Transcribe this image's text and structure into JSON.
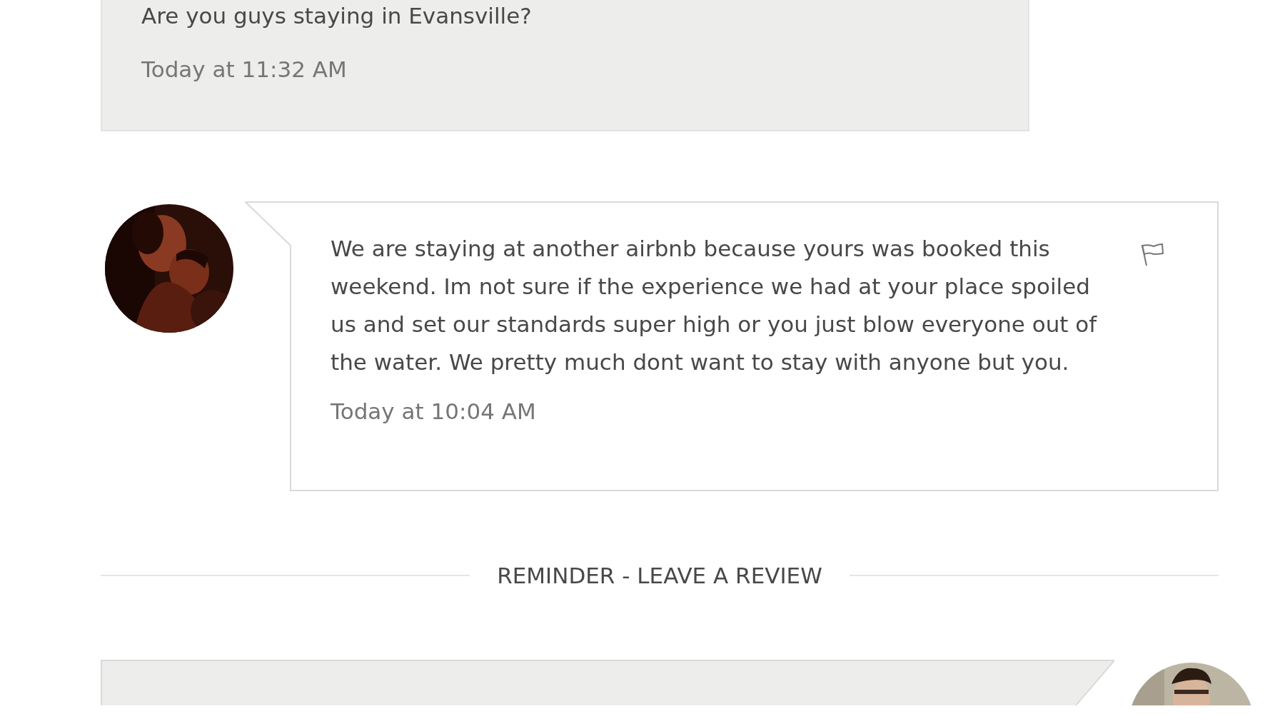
{
  "earlier_message": {
    "text": "Are you guys staying in Evansville?",
    "time": "Today at 11:32 AM"
  },
  "message": {
    "text": "We are staying at another airbnb because yours was booked this weekend. Im not sure if the experience we had at your place spoiled us and set our standards super high or you just blow everyone out of the water. We pretty much dont want to stay with anyone but you.",
    "time": "Today at 10:04 AM"
  },
  "divider": {
    "label": "REMINDER - LEAVE A REVIEW"
  }
}
